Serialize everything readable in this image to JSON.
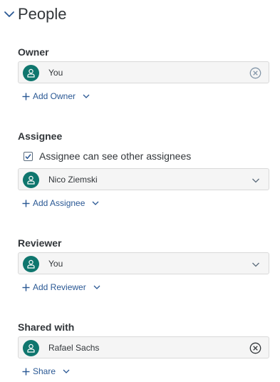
{
  "title": "People",
  "colors": {
    "accent": "#2a5894",
    "avatar": "#0f766e",
    "field_bg": "#f5f5f5"
  },
  "owner": {
    "label": "Owner",
    "value": "You",
    "action_icon": "clear-icon",
    "add_label": "Add Owner"
  },
  "assignee": {
    "label": "Assignee",
    "checkbox_label": "Assignee can see other assignees",
    "checkbox_checked": true,
    "value": "Nico Ziemski",
    "action_icon": "chevron-down-icon",
    "add_label": "Add Assignee"
  },
  "reviewer": {
    "label": "Reviewer",
    "value": "You",
    "action_icon": "chevron-down-icon",
    "add_label": "Add Reviewer"
  },
  "shared": {
    "label": "Shared with",
    "value": "Rafael Sachs",
    "action_icon": "clear-icon",
    "add_label": "Share"
  }
}
